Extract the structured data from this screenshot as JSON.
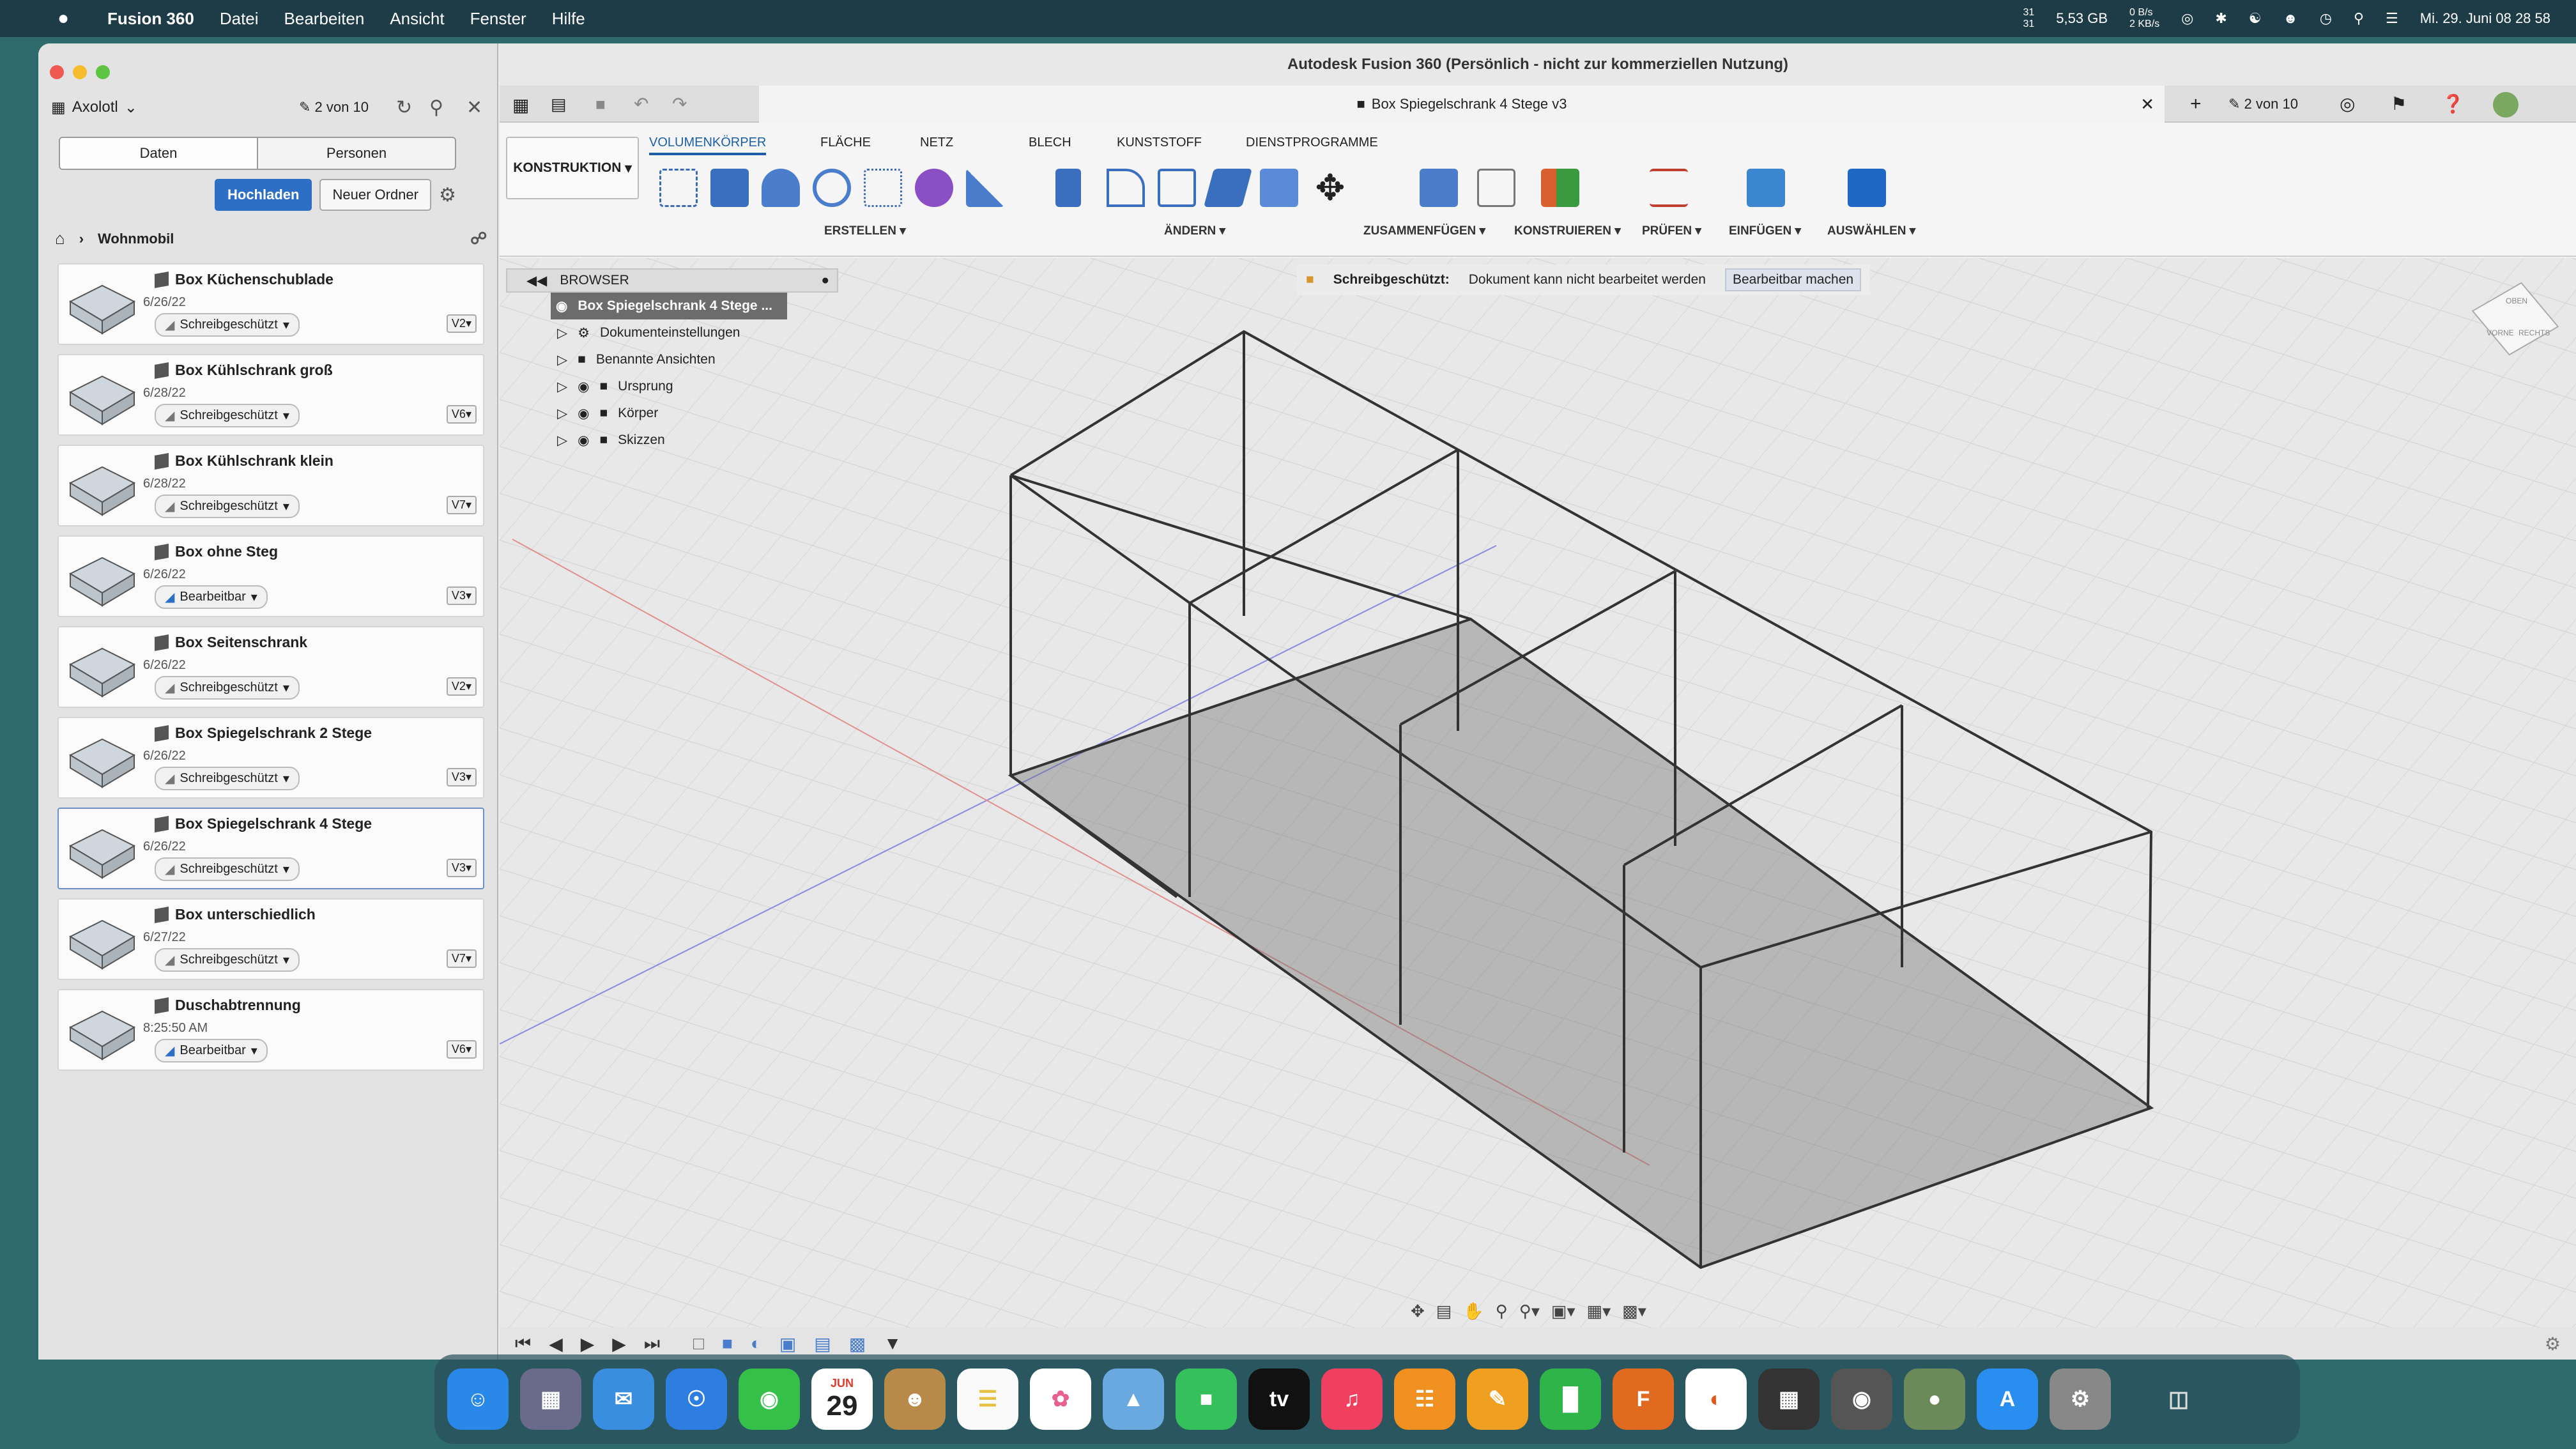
{
  "menubar": {
    "apple": "",
    "app_name": "Fusion 360",
    "items": [
      "Datei",
      "Bearbeiten",
      "Ansicht",
      "Fenster",
      "Hilfe"
    ],
    "status": {
      "disk": "5,53 GB",
      "net_up": "0 B/s",
      "net_down": "2 KB/s",
      "cpu_top": "31",
      "cpu_bottom": "31"
    },
    "datetime": "Mi. 29. Juni 08 28 58"
  },
  "data_panel": {
    "team": "Axolotl",
    "count": "2 von 10",
    "tabs": [
      "Daten",
      "Personen"
    ],
    "upload": "Hochladen",
    "new_folder": "Neuer Ordner",
    "breadcrumb": "Wohnmobil",
    "files": [
      {
        "name": "Box Küchenschublade",
        "date": "6/26/22",
        "status": "Schreibgeschützt",
        "version": "V2"
      },
      {
        "name": "Box Kühlschrank groß",
        "date": "6/28/22",
        "status": "Schreibgeschützt",
        "version": "V6"
      },
      {
        "name": "Box Kühlschrank klein",
        "date": "6/28/22",
        "status": "Schreibgeschützt",
        "version": "V7"
      },
      {
        "name": "Box ohne Steg",
        "date": "6/26/22",
        "status": "Bearbeitbar",
        "version": "V3"
      },
      {
        "name": "Box Seitenschrank",
        "date": "6/26/22",
        "status": "Schreibgeschützt",
        "version": "V2"
      },
      {
        "name": "Box Spiegelschrank 2 Stege",
        "date": "6/26/22",
        "status": "Schreibgeschützt",
        "version": "V3"
      },
      {
        "name": "Box Spiegelschrank 4 Stege",
        "date": "6/26/22",
        "status": "Schreibgeschützt",
        "version": "V3"
      },
      {
        "name": "Box unterschiedlich",
        "date": "6/27/22",
        "status": "Schreibgeschützt",
        "version": "V7"
      },
      {
        "name": "Duschabtrennung",
        "date": "8:25:50 AM",
        "status": "Bearbeitbar",
        "version": "V6"
      }
    ]
  },
  "window": {
    "title": "Autodesk Fusion 360 (Persönlich - nicht zur kommerziellen Nutzung)",
    "doc_tab": "Box Spiegelschrank 4 Stege v3",
    "right_count": "2 von 10"
  },
  "toolbar": {
    "workspace": "KONSTRUKTION",
    "tabs": [
      "VOLUMENKÖRPER",
      "FLÄCHE",
      "NETZ",
      "BLECH",
      "KUNSTSTOFF",
      "DIENSTPROGRAMME"
    ],
    "groups": [
      "ERSTELLEN",
      "ÄNDERN",
      "ZUSAMMENFÜGEN",
      "KONSTRUIEREN",
      "PRÜFEN",
      "EINFÜGEN",
      "AUSWÄHLEN"
    ]
  },
  "browser": {
    "title": "BROWSER",
    "root": "Box Spiegelschrank 4 Stege ...",
    "items": [
      "Dokumenteinstellungen",
      "Benannte Ansichten",
      "Ursprung",
      "Körper",
      "Skizzen"
    ]
  },
  "readonly_bar": {
    "label": "Schreibgeschützt:",
    "message": "Dokument kann nicht bearbeitet werden",
    "action": "Bearbeitbar machen"
  },
  "viewcube": {
    "front": "VORNE",
    "right": "RECHTS",
    "top": "OBEN"
  },
  "dock": {
    "calendar_month": "JUN",
    "calendar_day": "29",
    "tv": "tv",
    "fusion": "F"
  }
}
